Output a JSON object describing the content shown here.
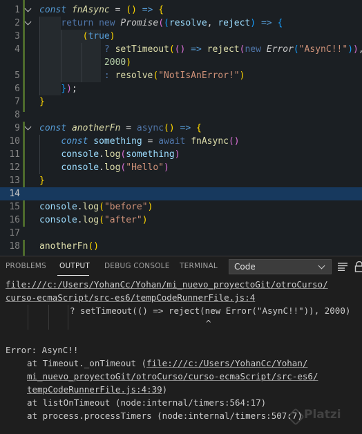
{
  "editor": {
    "line_numbers": [
      "1",
      "2",
      "3",
      "4",
      "",
      "5",
      "6",
      "7",
      "8",
      "9",
      "10",
      "11",
      "12",
      "13",
      "14",
      "15",
      "16",
      "17",
      "18"
    ],
    "active_line": "14"
  },
  "panel": {
    "tabs": [
      "PROBLEMS",
      "OUTPUT",
      "DEBUG CONSOLE",
      "TERMINAL"
    ],
    "active_tab": "OUTPUT",
    "output_channel": "Code"
  },
  "output": {
    "file_link_1": "file:///c:/Users/YohanCc/Yohan/mi_nuevo_proyectoGit/otroCurso/",
    "file_link_2": "curso-ecmaScript/src-es6/tempCodeRunnerFile.js:4",
    "code_excerpt": "? setTimeout(() => reject(new Error(\"AsynC!!\")), 2000)",
    "caret": "^",
    "error_title": "Error: AsynC!!",
    "stack_at_1": "at Timeout._onTimeout (",
    "stack_link_1": "file:///c:/Users/YohanCc/Yohan/",
    "stack_link_2": "mi_nuevo_proyectoGit/otroCurso/curso-ecmaScript/src-es6/",
    "stack_link_3": "tempCodeRunnerFile.js:4:39",
    "stack_close": ")",
    "stack_at_2": "at listOnTimeout (node:internal/timers:564:17)",
    "stack_at_3": "at process.processTimers (node:internal/timers:507:7)"
  },
  "watermark": "Platzi",
  "colors": {
    "editor_bg": "#1b1f23",
    "panel_bg": "#1e1e1e",
    "active_line_bg": "#17395e",
    "git_added": "#4d6a2c",
    "keyword": "#569cd6",
    "string": "#ce9178",
    "number": "#b5cea8",
    "function": "#dcdcaa"
  }
}
